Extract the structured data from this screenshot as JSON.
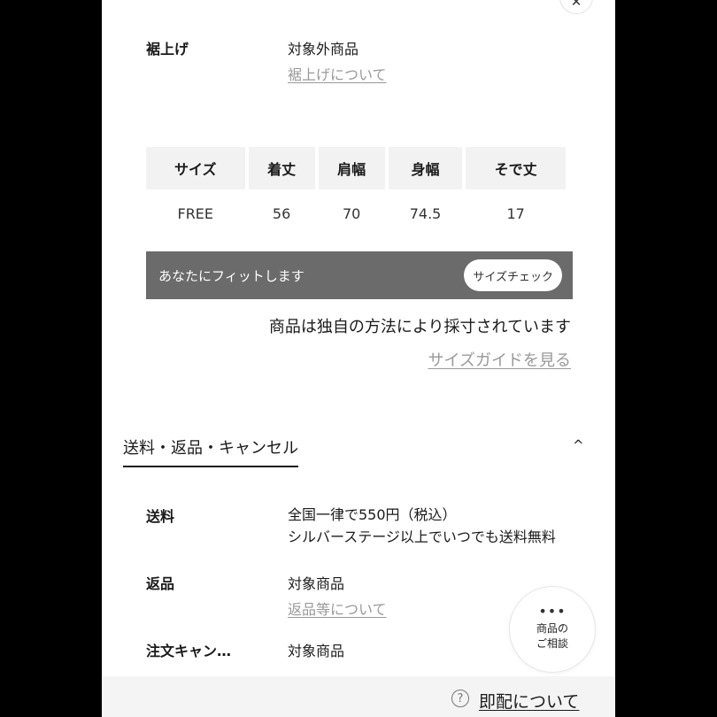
{
  "close_icon_glyph": "✕",
  "hem": {
    "label": "裾上げ",
    "value": "対象外商品",
    "link": "裾上げについて"
  },
  "size_table": {
    "headers": [
      "サイズ",
      "着丈",
      "肩幅",
      "身幅",
      "そで丈"
    ],
    "rows": [
      [
        "FREE",
        "56",
        "70",
        "74.5",
        "17"
      ]
    ]
  },
  "fit": {
    "text": "あなたにフィットします",
    "button": "サイズチェック"
  },
  "measure_note": "商品は独自の方法により採寸されています",
  "size_guide_link": "サイズガイドを見る",
  "section": {
    "title": "送料・返品・キャンセル",
    "chevron": "^"
  },
  "shipping": {
    "label": "送料",
    "line1": "全国一律で550円（税込）",
    "line2": "シルバーステージ以上でいつでも送料無料"
  },
  "returns": {
    "label": "返品",
    "value": "対象商品",
    "link": "返品等について"
  },
  "cancel": {
    "label": "注文キャン…",
    "value": "対象商品"
  },
  "consult": {
    "dots": "•••",
    "line1": "商品の",
    "line2": "ご相談"
  },
  "footer": {
    "help_glyph": "?",
    "link": "即配について"
  },
  "colors": {
    "fit_bar": "#6b6b6b",
    "link_gray": "#999999",
    "header_cell": "#f2f2f2"
  }
}
